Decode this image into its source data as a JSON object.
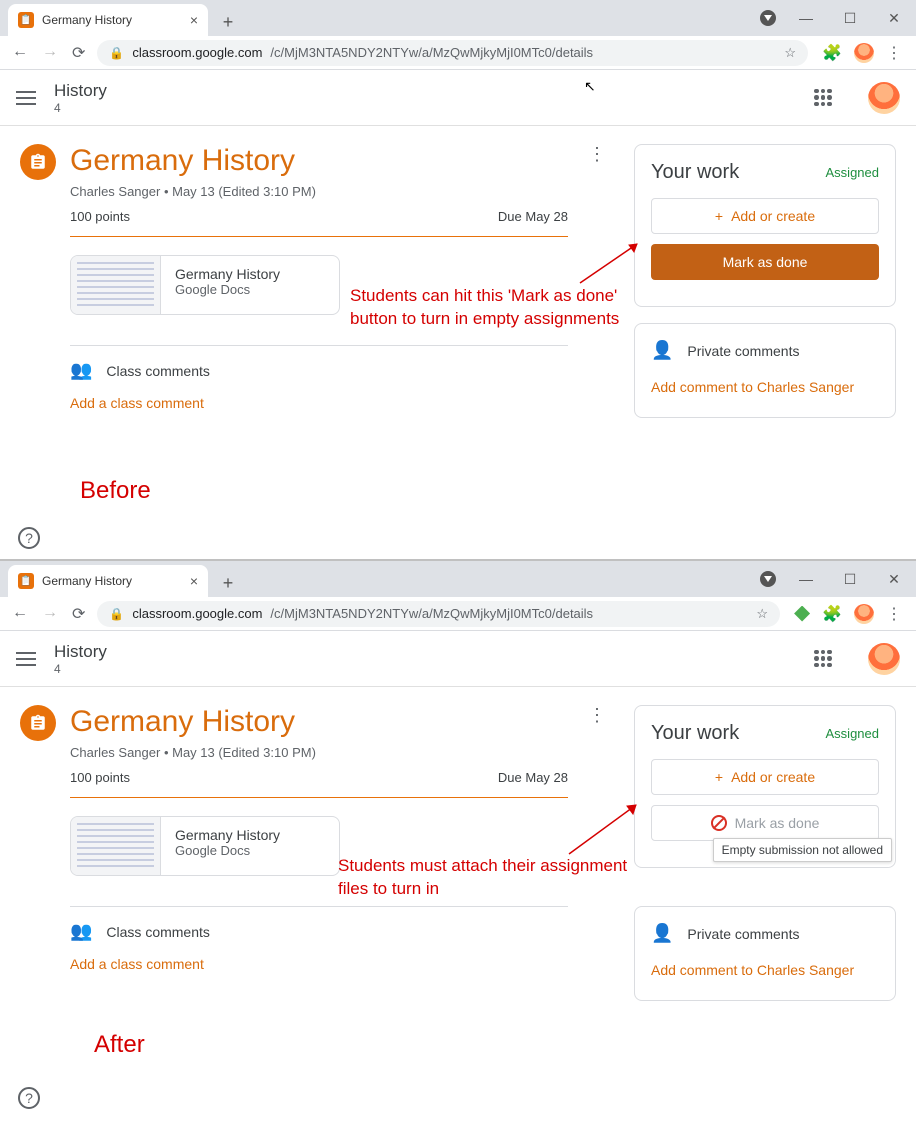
{
  "browser": {
    "tab_title": "Germany History",
    "url_domain": "classroom.google.com",
    "url_path": "/c/MjM3NTA5NDY2NTYw/a/MzQwMjkyMjI0MTc0/details"
  },
  "header": {
    "class_name": "History",
    "class_sub": "4"
  },
  "assignment": {
    "title": "Germany History",
    "author": "Charles Sanger",
    "edited": "May 13 (Edited 3:10 PM)",
    "points": "100 points",
    "due": "Due May 28",
    "attachment_title": "Germany History",
    "attachment_type": "Google Docs"
  },
  "comments": {
    "class_label": "Class comments",
    "add_class": "Add a class comment",
    "private_label": "Private comments",
    "add_private": "Add comment to Charles Sanger"
  },
  "work": {
    "title": "Your work",
    "status": "Assigned",
    "add_or_create": "Add or create",
    "mark_done": "Mark as done",
    "tooltip": "Empty submission not allowed"
  },
  "annotations": {
    "before_text1": "Students can hit this 'Mark as done'",
    "before_text2": "button to turn in empty assignments",
    "before_label": "Before",
    "after_text1": "Students must attach their assignment",
    "after_text2": "files to turn in",
    "after_label": "After"
  }
}
